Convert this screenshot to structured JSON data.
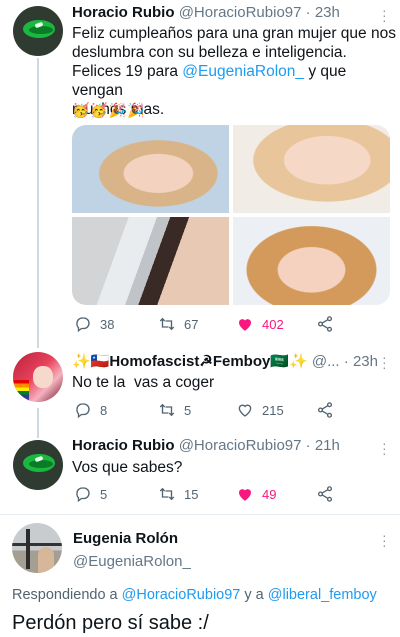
{
  "tweet1": {
    "name": "Horacio Rubio",
    "handle": "@HoracioRubio97",
    "time": "23h",
    "text_a": "Feliz cumpleaños para una gran mujer que nos",
    "text_b": "deslumbra con su belleza e inteligencia.",
    "text_c_pre": "Felices 19 para ",
    "mention": "@EugeniaRolon_",
    "text_c_post": " y que vengan",
    "text_d": "muchos mas.",
    "emojis": "🥳🥳🎉🎉",
    "replies": "38",
    "retweets": "67",
    "likes": "402"
  },
  "tweet2": {
    "name": "✨🇨🇱Homofascist☭Femboy🇸🇦✨",
    "handle": "@...",
    "time": "23h",
    "text": "No te la  vas a coger",
    "replies": "8",
    "retweets": "5",
    "likes": "215"
  },
  "tweet3": {
    "name": "Horacio Rubio",
    "handle": "@HoracioRubio97",
    "time": "21h",
    "text": "Vos que sabes?",
    "replies": "5",
    "retweets": "15",
    "likes": "49"
  },
  "tweet4": {
    "name": "Eugenia Rolón",
    "handle": "@EugeniaRolon_",
    "replying_pre": "Respondiendo a ",
    "replying_user1": "@HoracioRubio97",
    "replying_mid": " y a ",
    "replying_user2": "@liberal_femboy",
    "text": "Perdón pero sí sabe :/"
  },
  "colors": {
    "accent": "#1d9bf0",
    "like": "#f91880",
    "muted": "#536471"
  }
}
